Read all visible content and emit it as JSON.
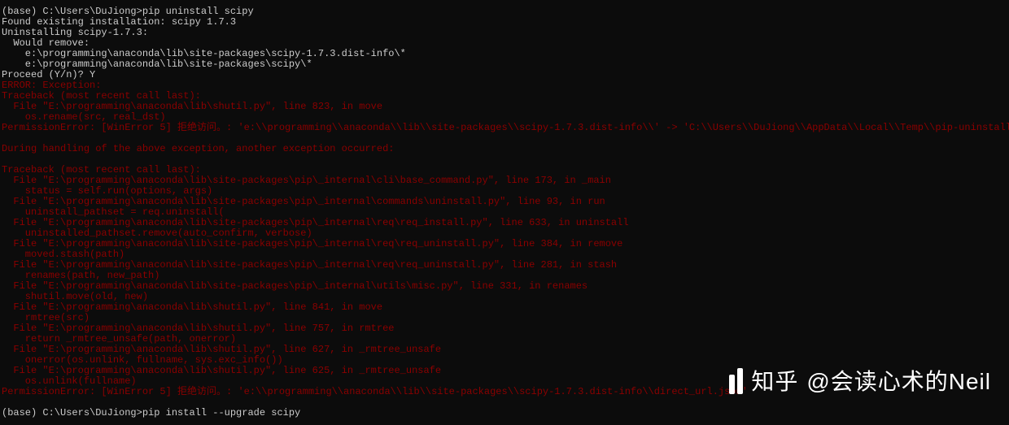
{
  "prompt_path": "(base) C:\\Users\\DuJiong>",
  "command": "pip uninstall scipy",
  "lines": [
    {
      "cls": "line-white",
      "text": "(base) C:\\Users\\DuJiong>pip uninstall scipy"
    },
    {
      "cls": "line-white",
      "text": "Found existing installation: scipy 1.7.3"
    },
    {
      "cls": "line-white",
      "text": "Uninstalling scipy-1.7.3:"
    },
    {
      "cls": "line-white",
      "text": "  Would remove:"
    },
    {
      "cls": "line-white",
      "text": "    e:\\programming\\anaconda\\lib\\site-packages\\scipy-1.7.3.dist-info\\*"
    },
    {
      "cls": "line-white",
      "text": "    e:\\programming\\anaconda\\lib\\site-packages\\scipy\\*"
    },
    {
      "cls": "line-white",
      "text": "Proceed (Y/n)? Y"
    },
    {
      "cls": "line-red",
      "text": "ERROR: Exception:"
    },
    {
      "cls": "line-red",
      "text": "Traceback (most recent call last):"
    },
    {
      "cls": "line-red",
      "text": "  File \"E:\\programming\\anaconda\\lib\\shutil.py\", line 823, in move"
    },
    {
      "cls": "line-red",
      "text": "    os.rename(src, real_dst)"
    },
    {
      "cls": "line-red",
      "text": "PermissionError: [WinError 5] 拒绝访问。: 'e:\\\\programming\\\\anaconda\\\\lib\\\\site-packages\\\\scipy-1.7.3.dist-info\\\\' -> 'C:\\\\Users\\\\DuJiong\\\\AppData\\\\Local\\\\Temp\\\\pip-uninstall-liwymrux'"
    },
    {
      "cls": "line-red",
      "text": ""
    },
    {
      "cls": "line-red",
      "text": "During handling of the above exception, another exception occurred:"
    },
    {
      "cls": "line-red",
      "text": ""
    },
    {
      "cls": "line-red",
      "text": "Traceback (most recent call last):"
    },
    {
      "cls": "line-red",
      "text": "  File \"E:\\programming\\anaconda\\lib\\site-packages\\pip\\_internal\\cli\\base_command.py\", line 173, in _main"
    },
    {
      "cls": "line-red",
      "text": "    status = self.run(options, args)"
    },
    {
      "cls": "line-red",
      "text": "  File \"E:\\programming\\anaconda\\lib\\site-packages\\pip\\_internal\\commands\\uninstall.py\", line 93, in run"
    },
    {
      "cls": "line-red",
      "text": "    uninstall_pathset = req.uninstall("
    },
    {
      "cls": "line-red",
      "text": "  File \"E:\\programming\\anaconda\\lib\\site-packages\\pip\\_internal\\req\\req_install.py\", line 633, in uninstall"
    },
    {
      "cls": "line-red",
      "text": "    uninstalled_pathset.remove(auto_confirm, verbose)"
    },
    {
      "cls": "line-red",
      "text": "  File \"E:\\programming\\anaconda\\lib\\site-packages\\pip\\_internal\\req\\req_uninstall.py\", line 384, in remove"
    },
    {
      "cls": "line-red",
      "text": "    moved.stash(path)"
    },
    {
      "cls": "line-red",
      "text": "  File \"E:\\programming\\anaconda\\lib\\site-packages\\pip\\_internal\\req\\req_uninstall.py\", line 281, in stash"
    },
    {
      "cls": "line-red",
      "text": "    renames(path, new_path)"
    },
    {
      "cls": "line-red",
      "text": "  File \"E:\\programming\\anaconda\\lib\\site-packages\\pip\\_internal\\utils\\misc.py\", line 331, in renames"
    },
    {
      "cls": "line-red",
      "text": "    shutil.move(old, new)"
    },
    {
      "cls": "line-red",
      "text": "  File \"E:\\programming\\anaconda\\lib\\shutil.py\", line 841, in move"
    },
    {
      "cls": "line-red",
      "text": "    rmtree(src)"
    },
    {
      "cls": "line-red",
      "text": "  File \"E:\\programming\\anaconda\\lib\\shutil.py\", line 757, in rmtree"
    },
    {
      "cls": "line-red",
      "text": "    return _rmtree_unsafe(path, onerror)"
    },
    {
      "cls": "line-red",
      "text": "  File \"E:\\programming\\anaconda\\lib\\shutil.py\", line 627, in _rmtree_unsafe"
    },
    {
      "cls": "line-red",
      "text": "    onerror(os.unlink, fullname, sys.exc_info())"
    },
    {
      "cls": "line-red",
      "text": "  File \"E:\\programming\\anaconda\\lib\\shutil.py\", line 625, in _rmtree_unsafe"
    },
    {
      "cls": "line-red",
      "text": "    os.unlink(fullname)"
    },
    {
      "cls": "line-red",
      "text": "PermissionError: [WinError 5] 拒绝访问。: 'e:\\\\programming\\\\anaconda\\\\lib\\\\site-packages\\\\scipy-1.7.3.dist-info\\\\direct_url.json'"
    },
    {
      "cls": "line-white",
      "text": ""
    },
    {
      "cls": "line-white",
      "text": "(base) C:\\Users\\DuJiong>pip install --upgrade scipy"
    }
  ],
  "watermark": {
    "brand": "知乎",
    "user": "@会读心术的Neil"
  }
}
